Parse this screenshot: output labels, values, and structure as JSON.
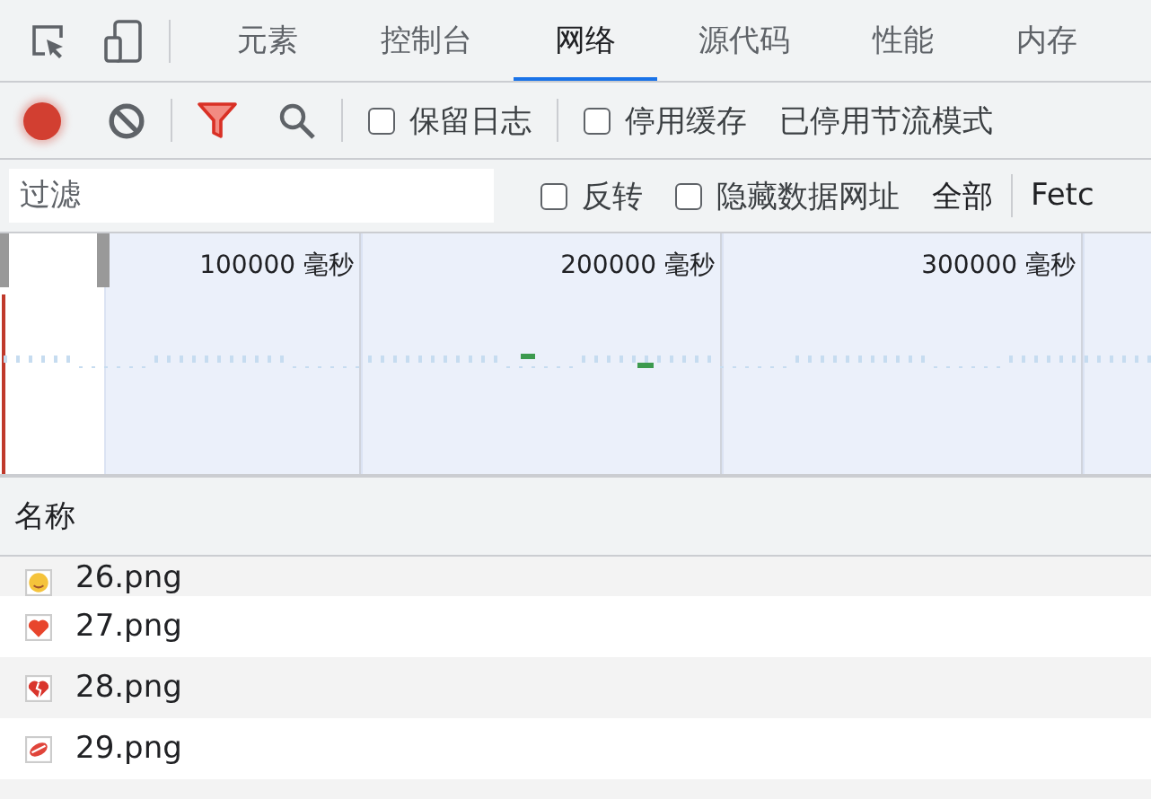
{
  "tabs": [
    {
      "label": "元素",
      "selected": false
    },
    {
      "label": "控制台",
      "selected": false
    },
    {
      "label": "网络",
      "selected": true
    },
    {
      "label": "源代码",
      "selected": false
    },
    {
      "label": "性能",
      "selected": false
    },
    {
      "label": "内存",
      "selected": false
    }
  ],
  "toolbar": {
    "recording": true,
    "options": [
      {
        "label": "保留日志",
        "checked": false
      },
      {
        "label": "停用缓存",
        "checked": false
      }
    ],
    "throttling": "已停用节流模式"
  },
  "filter_bar": {
    "placeholder": "过滤",
    "options": [
      {
        "label": "反转",
        "checked": false
      },
      {
        "label": "隐藏数据网址",
        "checked": false
      }
    ],
    "types": [
      "全部",
      "Fetc"
    ]
  },
  "overview": {
    "ticks": [
      "100000 毫秒",
      "200000 毫秒",
      "300000 毫秒"
    ]
  },
  "table": {
    "columns": [
      "名称"
    ],
    "rows": [
      {
        "name": "26.png",
        "kind": "face",
        "selected": false
      },
      {
        "name": "27.png",
        "kind": "heart",
        "selected": false
      },
      {
        "name": "28.png",
        "kind": "broken-heart",
        "selected": false
      },
      {
        "name": "29.png",
        "kind": "lips",
        "selected": false
      }
    ]
  }
}
